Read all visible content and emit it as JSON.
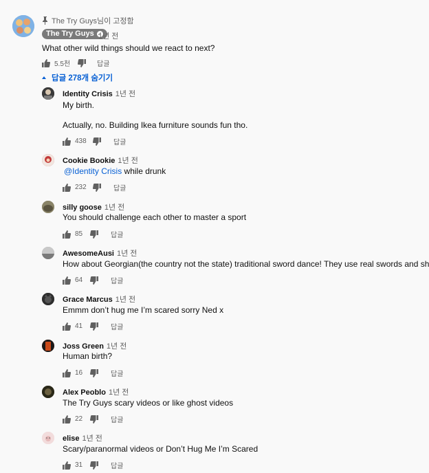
{
  "pinned": {
    "pinned_by": "The Try Guys님이 고정함",
    "author": "The Try Guys",
    "time": "1년 전",
    "text": "What other wild things should we react to next?",
    "likes": "5.5천",
    "reply_label": "답글"
  },
  "replies_toggle": "답글 278개 숨기기",
  "replies": [
    {
      "author": "Identity Crisis",
      "time": "1년 전",
      "line1": "My birth.",
      "line2": "Actually, no. Building Ikea furniture sounds fun tho.",
      "likes": "438",
      "reply_label": "답글",
      "avatar_color": "#3a3a3a"
    },
    {
      "author": "Cookie Bookie",
      "time": "1년 전",
      "mention": "@Identity Crisis",
      "line1": " while drunk",
      "likes": "232",
      "reply_label": "답글",
      "avatar_color": "#c23a3a"
    },
    {
      "author": "silly goose",
      "time": "1년 전",
      "line1": "You should challenge each other to master a sport",
      "likes": "85",
      "reply_label": "답글",
      "avatar_color": "#6f6a55"
    },
    {
      "author": "AwesomeAusi",
      "time": "1년 전",
      "line1": "How about Georgian(the country not the state) traditional sword dance! They use real swords and shields",
      "likes": "64",
      "reply_label": "답글",
      "avatar_color": "#9a9a9a"
    },
    {
      "author": "Grace Marcus",
      "time": "1년 전",
      "line1": "Emmm don’t hug me I’m scared sorry Ned x",
      "likes": "41",
      "reply_label": "답글",
      "avatar_color": "#2e2e2e"
    },
    {
      "author": "Joss Green",
      "time": "1년 전",
      "line1": "Human birth?",
      "likes": "16",
      "reply_label": "답글",
      "avatar_color": "#c94a1a"
    },
    {
      "author": "Alex Peoblo",
      "time": "1년 전",
      "line1": "The Try Guys scary videos or like ghost videos",
      "likes": "22",
      "reply_label": "답글",
      "avatar_color": "#3d3a2a"
    },
    {
      "author": "elise",
      "time": "1년 전",
      "line1": "Scary/paranormal videos or Don’t Hug Me I’m Scared",
      "likes": "31",
      "reply_label": "답글",
      "avatar_color": "#e9c8c8"
    }
  ]
}
